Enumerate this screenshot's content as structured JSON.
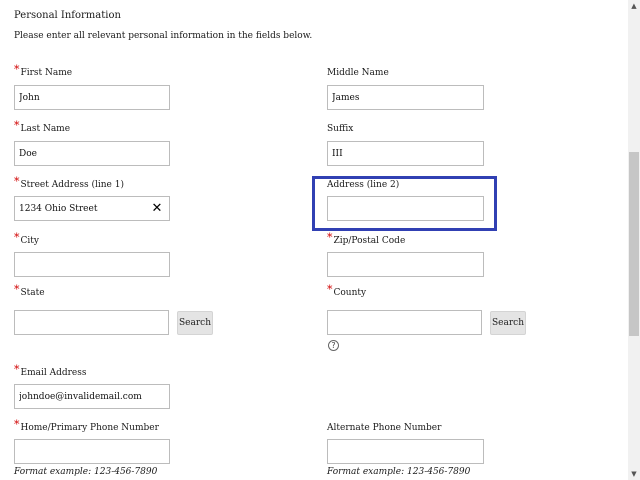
{
  "section": {
    "title": "Personal Information",
    "instructions": "Please enter all relevant personal information in the fields below."
  },
  "required_mark": "*",
  "fields": {
    "first_name": {
      "label": "First Name",
      "value": "John",
      "required": true
    },
    "middle_name": {
      "label": "Middle Name",
      "value": "James",
      "required": false
    },
    "last_name": {
      "label": "Last Name",
      "value": "Doe",
      "required": true
    },
    "suffix": {
      "label": "Suffix",
      "value": "III",
      "required": false
    },
    "street1": {
      "label": "Street Address (line 1)",
      "value": "1234 Ohio Street",
      "required": true
    },
    "street2": {
      "label": "Address (line 2)",
      "value": "",
      "required": false
    },
    "city": {
      "label": "City",
      "value": "",
      "required": true
    },
    "zip": {
      "label": "Zip/Postal Code",
      "value": "",
      "required": true
    },
    "state": {
      "label": "State",
      "value": "",
      "required": true
    },
    "county": {
      "label": "County",
      "value": "",
      "required": true
    },
    "email": {
      "label": "Email Address",
      "value": "johndoe@invalidemail.com",
      "required": true
    },
    "home_phone": {
      "label": "Home/Primary Phone Number",
      "value": "",
      "required": true
    },
    "alt_phone": {
      "label": "Alternate Phone Number",
      "value": "",
      "required": false
    }
  },
  "buttons": {
    "search_label": "Search"
  },
  "icons": {
    "clear": "clear-icon",
    "help": "help-icon",
    "clear_glyph": "✕",
    "help_glyph": "?"
  },
  "format_example": "Format example:  123-456-7890",
  "colors": {
    "required": "#d00000",
    "focus_outline": "#3140b3"
  }
}
